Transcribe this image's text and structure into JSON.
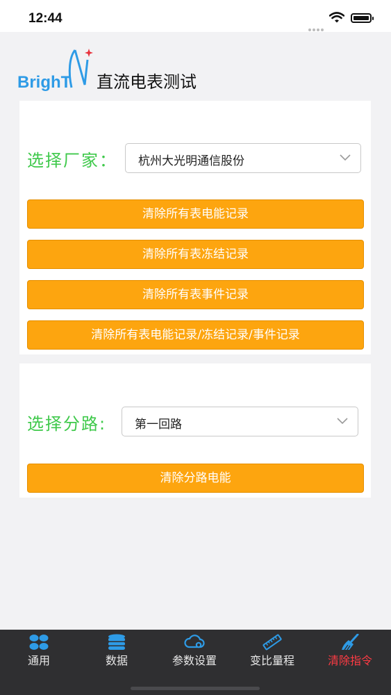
{
  "status": {
    "time": "12:44"
  },
  "header": {
    "logo_text": "BrighT",
    "title": "直流电表测试"
  },
  "vendor_card": {
    "label": "选择厂家：",
    "selected": "杭州大光明通信股份",
    "buttons": [
      "清除所有表电能记录",
      "清除所有表冻结记录",
      "清除所有表事件记录",
      "清除所有表电能记录/冻结记录/事件记录"
    ]
  },
  "branch_card": {
    "label": "选择分路:",
    "selected": "第一回路",
    "button": "清除分路电能"
  },
  "tabs": [
    {
      "label": "通用",
      "icon": "grid-icon"
    },
    {
      "label": "数据",
      "icon": "database-icon"
    },
    {
      "label": "参数设置",
      "icon": "cloud-gear-icon"
    },
    {
      "label": "变比量程",
      "icon": "ruler-icon"
    },
    {
      "label": "清除指令",
      "icon": "broom-icon",
      "active": true
    }
  ],
  "colors": {
    "accent": "#fda50f",
    "label_green": "#3fc94b",
    "active_tab": "#ff3b44",
    "tab_icon_blue": "#2e9be6"
  }
}
